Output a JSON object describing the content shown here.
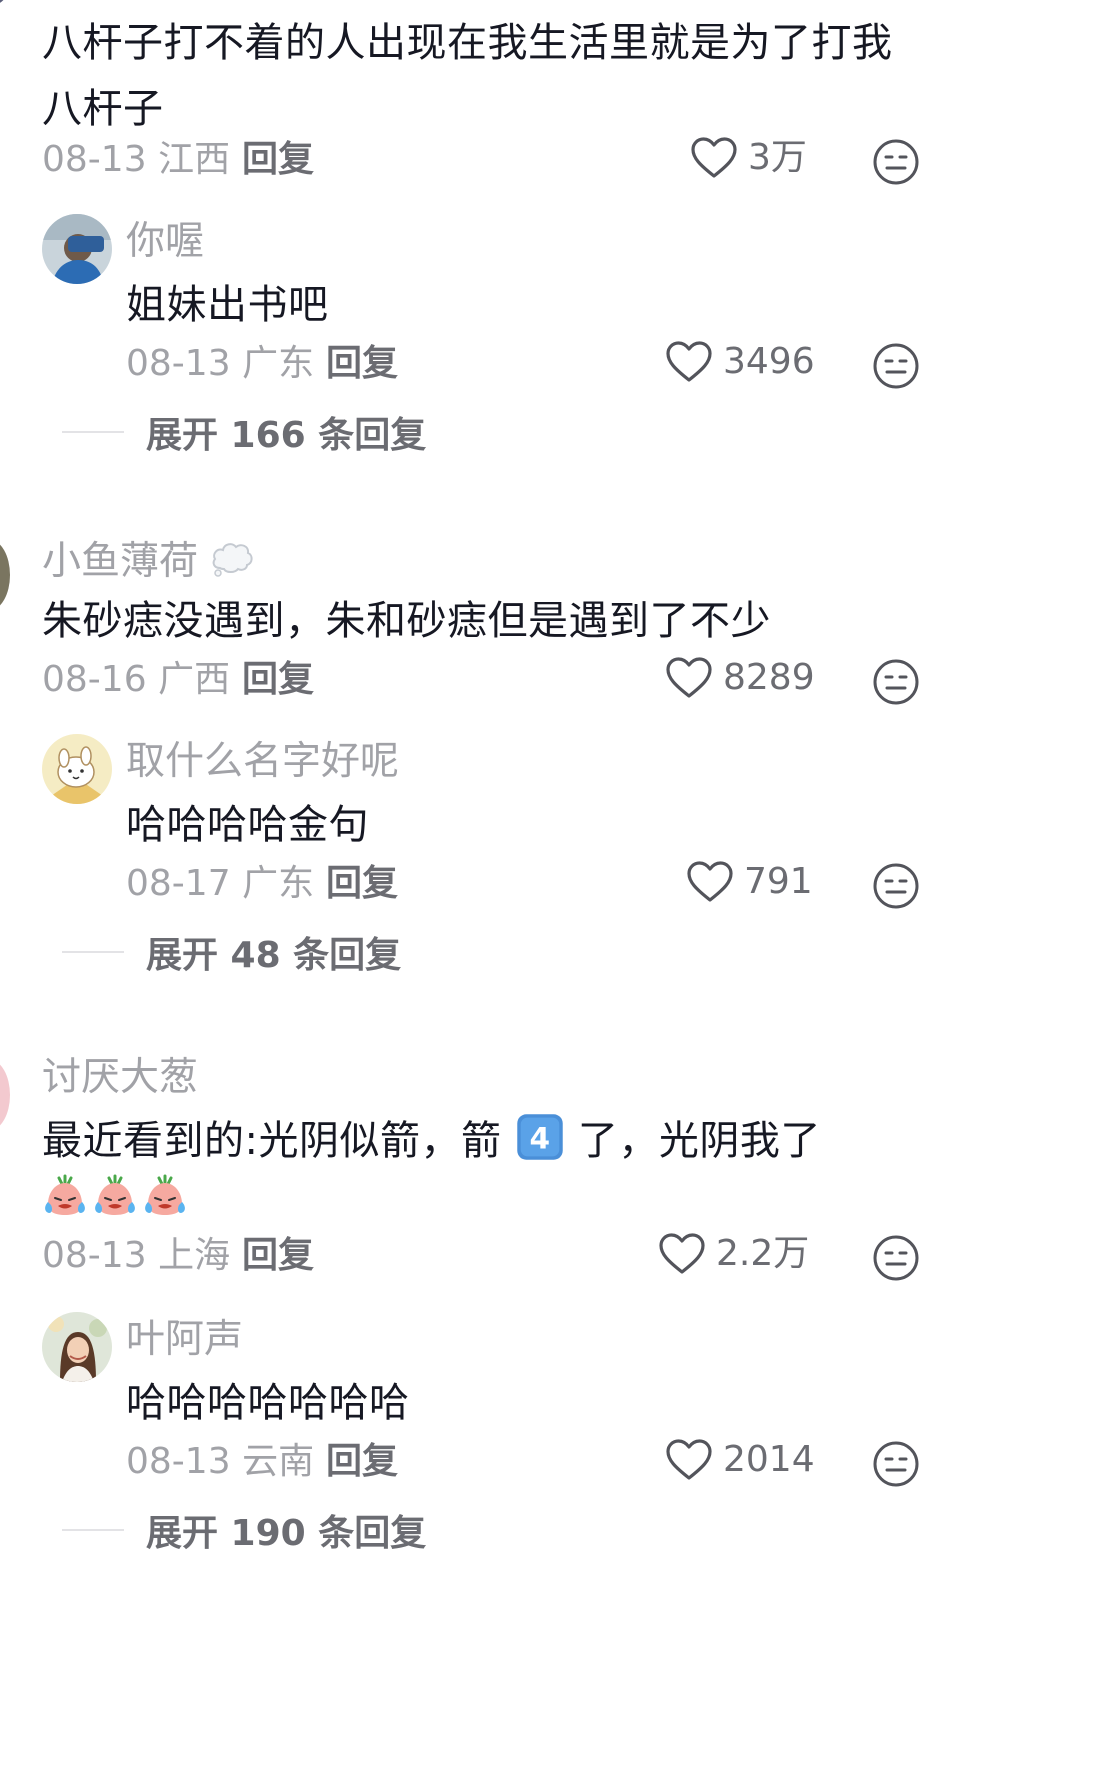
{
  "comments": [
    {
      "content": "八杆子打不着的人出现在我生活里就是为了打我八杆子",
      "date": "08-13",
      "location": "江西",
      "reply_label": "回复",
      "likes": "3万",
      "replies": [
        {
          "username": "你喔",
          "content": "姐妹出书吧",
          "date": "08-13",
          "location": "广东",
          "reply_label": "回复",
          "likes": "3496"
        }
      ],
      "expand_label": "展开 166 条回复"
    },
    {
      "username": "小鱼薄荷",
      "content": "朱砂痣没遇到，朱和砂痣但是遇到了不少",
      "date": "08-16",
      "location": "广西",
      "reply_label": "回复",
      "likes": "8289",
      "replies": [
        {
          "username": "取什么名字好呢",
          "content": "哈哈哈哈金句",
          "date": "08-17",
          "location": "广东",
          "reply_label": "回复",
          "likes": "791"
        }
      ],
      "expand_label": "展开 48 条回复"
    },
    {
      "username": "讨厌大葱",
      "content_part1": "最近看到的:光阴似箭，箭",
      "keycap": "4",
      "content_part2": "了，光阴我了",
      "date": "08-13",
      "location": "上海",
      "reply_label": "回复",
      "likes": "2.2万",
      "replies": [
        {
          "username": "叶阿声",
          "content": "哈哈哈哈哈哈哈",
          "date": "08-13",
          "location": "云南",
          "reply_label": "回复",
          "likes": "2014"
        }
      ],
      "expand_label": "展开 190 条回复"
    }
  ],
  "colors": {
    "text_primary": "#161823",
    "text_secondary": "#a1a2a7",
    "action": "#6b6c72"
  },
  "icons": {
    "like": "heart-outline-icon",
    "dislike": "neutral-face-icon",
    "keycap": "keycap-4-emoji",
    "crying": "crying-face-emoji"
  }
}
